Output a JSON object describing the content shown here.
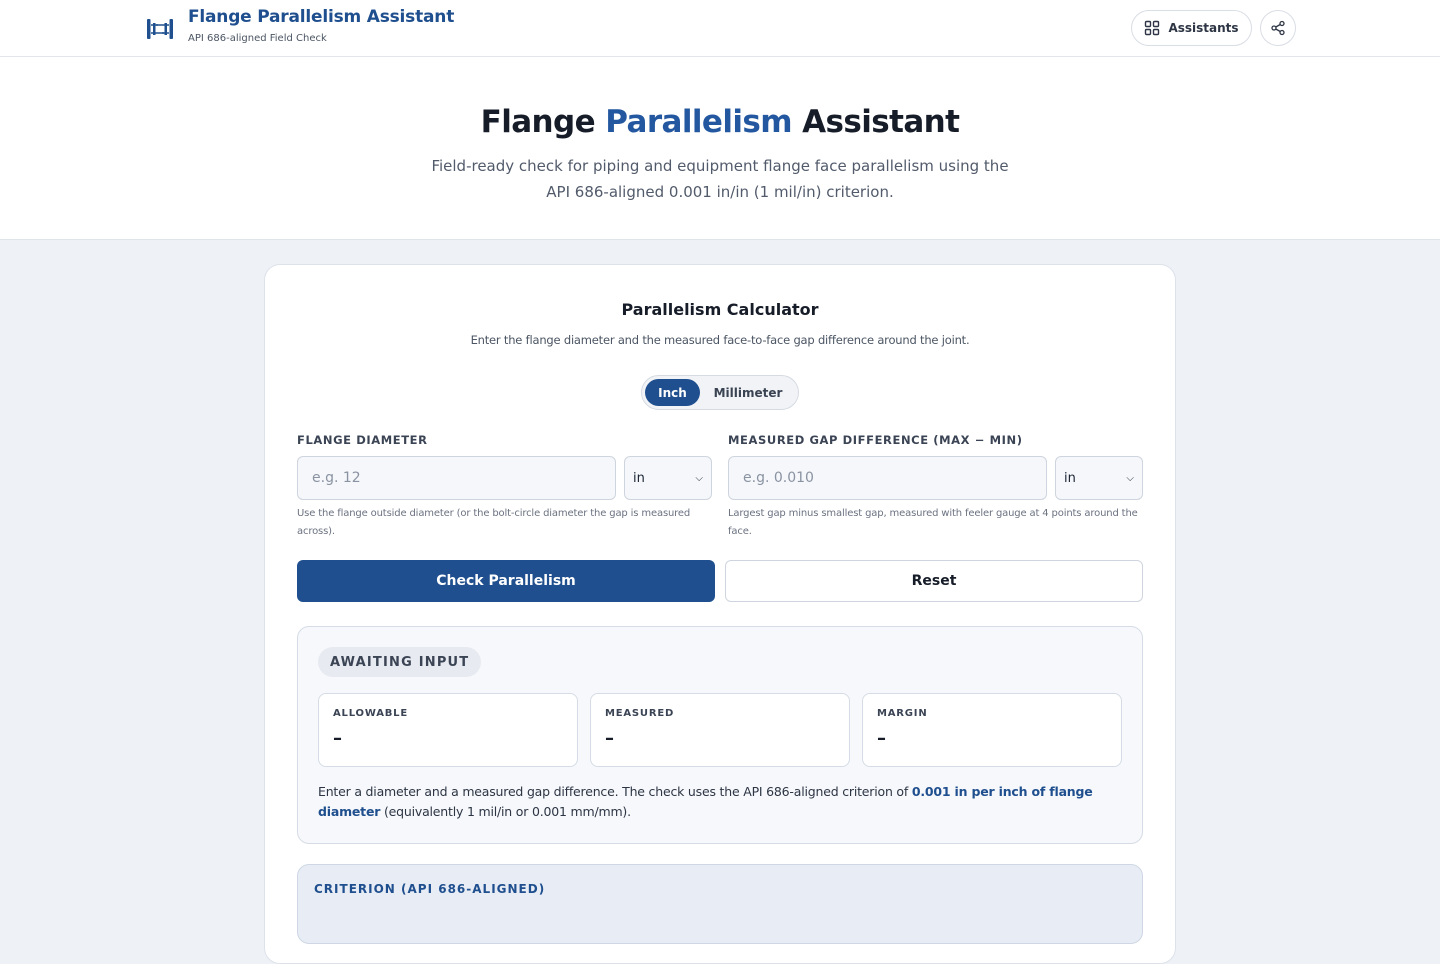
{
  "header": {
    "title": "Flange Parallelism Assistant",
    "subtitle": "API 686-aligned Field Check",
    "assistants_label": "Assistants"
  },
  "hero": {
    "title_before": "Flange ",
    "title_accent": "Parallelism",
    "title_after": " Assistant",
    "description": "Field-ready check for piping and equipment flange face parallelism using the API 686-aligned 0.001 in/in (1 mil/in) criterion."
  },
  "calculator": {
    "title": "Parallelism Calculator",
    "description": "Enter the flange diameter and the measured face-to-face gap difference around the joint.",
    "unit_toggle": {
      "options": [
        "Inch",
        "Millimeter"
      ],
      "selected": "Inch"
    },
    "diameter": {
      "label": "FLANGE DIAMETER",
      "placeholder": "e.g. 12",
      "value": "",
      "unit": "in",
      "hint": "Use the flange outside diameter (or the bolt-circle diameter the gap is measured across)."
    },
    "gap": {
      "label": "MEASURED GAP DIFFERENCE (MAX − MIN)",
      "placeholder": "e.g. 0.010",
      "value": "",
      "unit": "in",
      "hint": "Largest gap minus smallest gap, measured with feeler gauge at 4 points around the face."
    },
    "check_button": "Check Parallelism",
    "reset_button": "Reset"
  },
  "result": {
    "status": "AWAITING INPUT",
    "metrics": [
      {
        "label": "ALLOWABLE",
        "value": "–"
      },
      {
        "label": "MEASURED",
        "value": "–"
      },
      {
        "label": "MARGIN",
        "value": "–"
      }
    ],
    "note_before": "Enter a diameter and a measured gap difference. The check uses the API 686-aligned criterion of ",
    "note_emphasis": "0.001 in per inch of flange diameter",
    "note_after": " (equivalently 1 mil/in or 0.001 mm/mm)."
  },
  "criterion": {
    "title": "CRITERION (API 686-ALIGNED)"
  },
  "colors": {
    "brand": "#1f4f8e",
    "accent_text": "#2357a0",
    "page_bg": "#eef2f7"
  },
  "icons": [
    "flange-logo-icon",
    "grid-icon",
    "share-icon",
    "chevron-down-icon"
  ]
}
